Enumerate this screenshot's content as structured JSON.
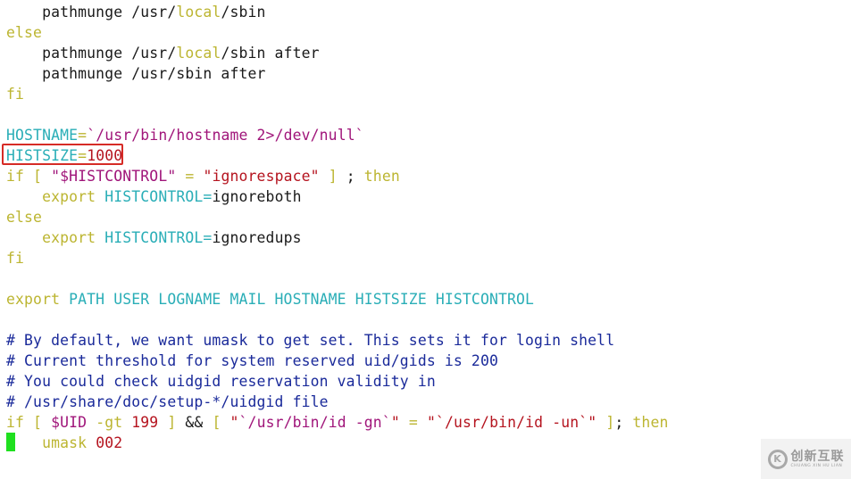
{
  "editor": {
    "lines": [
      [
        {
          "t": "    pathmunge /usr/",
          "c": "default"
        },
        {
          "t": "local",
          "c": "keyword"
        },
        {
          "t": "/sbin",
          "c": "default"
        }
      ],
      [
        {
          "t": "else",
          "c": "keyword"
        }
      ],
      [
        {
          "t": "    pathmunge /usr/",
          "c": "default"
        },
        {
          "t": "local",
          "c": "keyword"
        },
        {
          "t": "/sbin after",
          "c": "default"
        }
      ],
      [
        {
          "t": "    pathmunge /usr/sbin after",
          "c": "default"
        }
      ],
      [
        {
          "t": "fi",
          "c": "keyword"
        }
      ],
      [
        {
          "t": "",
          "c": "default"
        }
      ],
      [
        {
          "t": "HOSTNAME",
          "c": "var"
        },
        {
          "t": "=",
          "c": "op"
        },
        {
          "t": "`/usr/bin/hostname 2>/dev/null`",
          "c": "string"
        }
      ],
      [
        {
          "t": "HISTSIZE",
          "c": "var"
        },
        {
          "t": "=",
          "c": "op"
        },
        {
          "t": "1000",
          "c": "number"
        }
      ],
      [
        {
          "t": "if [ ",
          "c": "keyword"
        },
        {
          "t": "\"",
          "c": "string"
        },
        {
          "t": "$HISTCONTROL",
          "c": "string"
        },
        {
          "t": "\"",
          "c": "string"
        },
        {
          "t": " = ",
          "c": "keyword"
        },
        {
          "t": "\"ignorespace\"",
          "c": "number"
        },
        {
          "t": " ] ",
          "c": "keyword"
        },
        {
          "t": ";",
          "c": "default"
        },
        {
          "t": " then",
          "c": "keyword"
        }
      ],
      [
        {
          "t": "    ",
          "c": "default"
        },
        {
          "t": "export",
          "c": "keyword"
        },
        {
          "t": " ",
          "c": "default"
        },
        {
          "t": "HISTCONTROL",
          "c": "var"
        },
        {
          "t": "=",
          "c": "var"
        },
        {
          "t": "ignoreboth",
          "c": "default"
        }
      ],
      [
        {
          "t": "else",
          "c": "keyword"
        }
      ],
      [
        {
          "t": "    ",
          "c": "default"
        },
        {
          "t": "export",
          "c": "keyword"
        },
        {
          "t": " ",
          "c": "default"
        },
        {
          "t": "HISTCONTROL",
          "c": "var"
        },
        {
          "t": "=",
          "c": "var"
        },
        {
          "t": "ignoredups",
          "c": "default"
        }
      ],
      [
        {
          "t": "fi",
          "c": "keyword"
        }
      ],
      [
        {
          "t": "",
          "c": "default"
        }
      ],
      [
        {
          "t": "export",
          "c": "keyword"
        },
        {
          "t": " PATH USER LOGNAME MAIL HOSTNAME HISTSIZE HISTCONTROL",
          "c": "var"
        }
      ],
      [
        {
          "t": "",
          "c": "default"
        }
      ],
      [
        {
          "t": "# By default, we want umask to get set. This sets it for login shell",
          "c": "comment"
        }
      ],
      [
        {
          "t": "# Current threshold for system reserved uid/gids is 200",
          "c": "comment"
        }
      ],
      [
        {
          "t": "# You could check uidgid reservation validity in",
          "c": "comment"
        }
      ],
      [
        {
          "t": "# /usr/share/doc/setup-*/uidgid file",
          "c": "comment"
        }
      ],
      [
        {
          "t": "if [ ",
          "c": "keyword"
        },
        {
          "t": "$UID",
          "c": "string"
        },
        {
          "t": " -gt ",
          "c": "keyword"
        },
        {
          "t": "199",
          "c": "number"
        },
        {
          "t": " ] ",
          "c": "keyword"
        },
        {
          "t": "&&",
          "c": "default"
        },
        {
          "t": " [ ",
          "c": "keyword"
        },
        {
          "t": "\"",
          "c": "number"
        },
        {
          "t": "`/usr/bin/id -gn`",
          "c": "string"
        },
        {
          "t": "\"",
          "c": "number"
        },
        {
          "t": " = ",
          "c": "keyword"
        },
        {
          "t": "\"",
          "c": "number"
        },
        {
          "t": "`/usr/bin/id -un`",
          "c": "number"
        },
        {
          "t": "\"",
          "c": "number"
        },
        {
          "t": " ]",
          "c": "keyword"
        },
        {
          "t": ";",
          "c": "default"
        },
        {
          "t": " then",
          "c": "keyword"
        }
      ],
      [
        {
          "t": "    ",
          "c": "default"
        },
        {
          "t": "umask",
          "c": "keyword"
        },
        {
          "t": " ",
          "c": "default"
        },
        {
          "t": "002",
          "c": "number"
        }
      ]
    ],
    "highlighted_line_index": 7,
    "highlight_color": "#d62b26",
    "cursor_color": "#1fe01f"
  },
  "watermark": {
    "logo_glyph": "K",
    "main_text": "创新互联",
    "sub_text": "CHUANG XIN HU LIAN"
  }
}
